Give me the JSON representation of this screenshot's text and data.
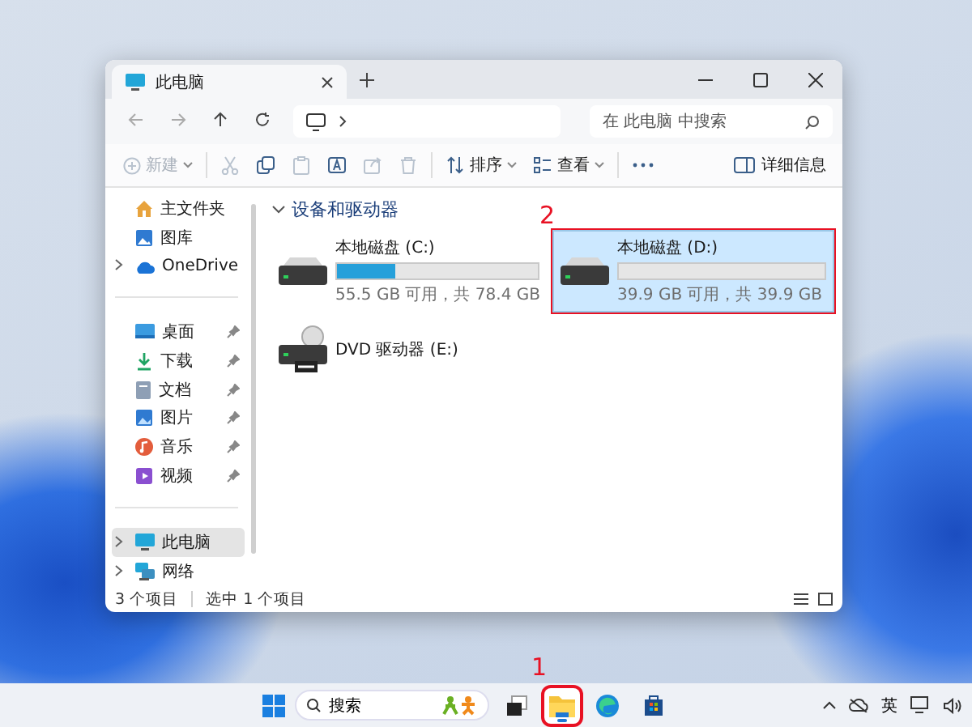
{
  "window": {
    "tab_title": "此电脑",
    "search_placeholder": "在 此电脑 中搜索"
  },
  "toolbar": {
    "items": [
      {
        "kind": "new",
        "label": "新建",
        "disabled": true
      },
      {
        "kind": "cut",
        "disabled": true
      },
      {
        "kind": "copy",
        "disabled": false
      },
      {
        "kind": "paste",
        "disabled": true
      },
      {
        "kind": "rename",
        "disabled": false
      },
      {
        "kind": "share",
        "disabled": true
      },
      {
        "kind": "delete",
        "disabled": true
      },
      {
        "kind": "sort",
        "label": "排序",
        "disabled": false
      },
      {
        "kind": "view",
        "label": "查看",
        "disabled": false
      },
      {
        "kind": "more",
        "disabled": false
      }
    ],
    "details": "详细信息"
  },
  "sidebar": {
    "groups": [
      [
        {
          "kind": "home",
          "label": "主文件夹",
          "selected": false
        },
        {
          "kind": "gallery",
          "label": "图库",
          "selected": false
        },
        {
          "kind": "cloud",
          "label": "OneDrive",
          "selected": false,
          "expanded": false
        }
      ],
      [
        {
          "kind": "desktop",
          "label": "桌面",
          "selected": false,
          "pinned": true
        },
        {
          "kind": "download",
          "label": "下载",
          "selected": false,
          "pinned": true
        },
        {
          "kind": "docs",
          "label": "文档",
          "selected": false,
          "pinned": true
        },
        {
          "kind": "pictures",
          "label": "图片",
          "selected": false,
          "pinned": true
        },
        {
          "kind": "music",
          "label": "音乐",
          "selected": false,
          "pinned": true
        },
        {
          "kind": "videos",
          "label": "视频",
          "selected": false,
          "pinned": true
        }
      ],
      [
        {
          "kind": "pc",
          "label": "此电脑",
          "selected": true,
          "expanded": false
        },
        {
          "kind": "network",
          "label": "网络",
          "selected": false,
          "expanded": false
        }
      ]
    ]
  },
  "content": {
    "section": {
      "title": "设备和驱动器",
      "expanded": true
    },
    "drives": [
      {
        "kind": "disk",
        "name": "本地磁盘 (C:)",
        "level": 0.29,
        "space": "55.5 GB 可用，共 78.4 GB",
        "selected": false,
        "annotated": false
      },
      {
        "kind": "disk",
        "name": "本地磁盘 (D:)",
        "level": 0,
        "space": "39.9 GB 可用，共 39.9 GB",
        "selected": true,
        "annotated": true,
        "annotation_label": "2"
      },
      {
        "kind": "dvd",
        "name": "DVD 驱动器 (E:)",
        "selected": false,
        "annotated": false
      }
    ]
  },
  "status_bar": {
    "items": "3 个项目",
    "selection": "选中 1 个项目"
  },
  "taskbar": {
    "search_placeholder": "搜索",
    "apps": [
      {
        "kind": "taskview",
        "active": false,
        "annotated": false
      },
      {
        "kind": "explorer",
        "active": true,
        "annotated": true,
        "annotation_label": "1"
      },
      {
        "kind": "edge",
        "active": false,
        "annotated": false
      },
      {
        "kind": "store",
        "active": false,
        "annotated": false
      }
    ],
    "input_method": "英"
  }
}
